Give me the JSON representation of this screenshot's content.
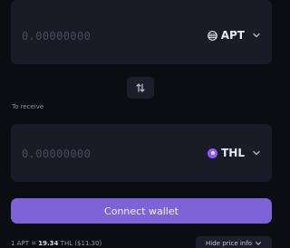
{
  "pay": {
    "amount_placeholder": "0.00000000",
    "token_symbol": "APT",
    "token_icon": "apt-icon"
  },
  "swap": {
    "icon": "swap-arrows-icon"
  },
  "receive": {
    "label": "To receive",
    "amount_placeholder": "0.00000000",
    "token_symbol": "THL",
    "token_icon": "thl-icon"
  },
  "actions": {
    "connect_label": "Connect wallet"
  },
  "price_info": {
    "prefix": "1 APT = ",
    "rate": "19.34",
    "suffix": " THL ($11.30)",
    "toggle_label": "Hide price info"
  },
  "colors": {
    "background": "#0c0c13",
    "panel": "#1b1b28",
    "accent": "#7c63d8",
    "thl_token": "#8b5cf6"
  }
}
